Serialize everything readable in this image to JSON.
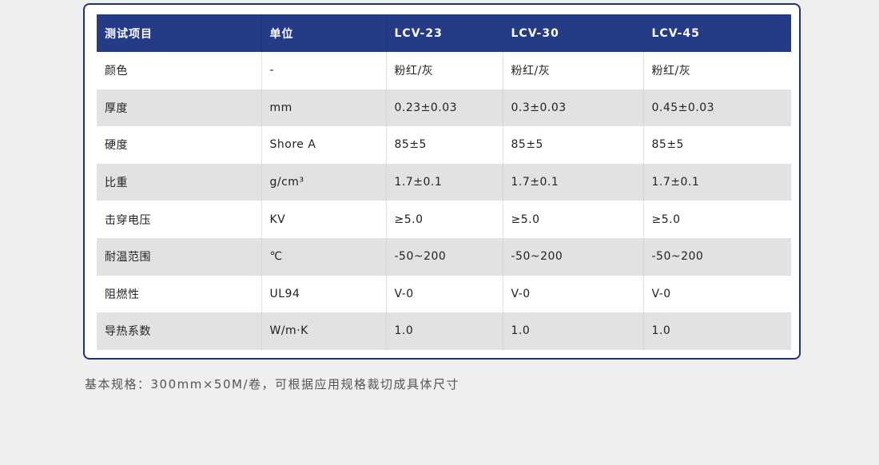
{
  "table": {
    "headers": [
      "测试项目",
      "单位",
      "LCV-23",
      "LCV-30",
      "LCV-45"
    ],
    "rows": [
      [
        "颜色",
        "-",
        "粉红/灰",
        "粉红/灰",
        "粉红/灰"
      ],
      [
        "厚度",
        "mm",
        "0.23±0.03",
        "0.3±0.03",
        "0.45±0.03"
      ],
      [
        "硬度",
        "Shore A",
        "85±5",
        "85±5",
        "85±5"
      ],
      [
        "比重",
        "g/cm³",
        "1.7±0.1",
        "1.7±0.1",
        "1.7±0.1"
      ],
      [
        "击穿电压",
        "KV",
        "≥5.0",
        "≥5.0",
        "≥5.0"
      ],
      [
        "耐温范围",
        "℃",
        "-50~200",
        "-50~200",
        "-50~200"
      ],
      [
        "阻燃性",
        "UL94",
        "V-0",
        "V-0",
        "V-0"
      ],
      [
        "导热系数",
        "W/m·K",
        "1.0",
        "1.0",
        "1.0"
      ]
    ]
  },
  "footnote": "基本规格：300mm×50M/卷，可根据应用规格裁切成具体尺寸",
  "colors": {
    "header_bg": "#263b86",
    "border": "#23336f",
    "row_alt": "#e2e2e2",
    "page_bg": "#efefef"
  }
}
